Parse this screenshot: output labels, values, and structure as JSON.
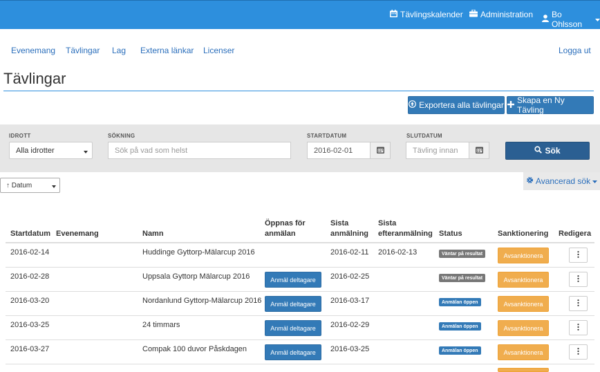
{
  "topbar": {
    "calendar_label": "Tävlingskalender",
    "admin_label": "Administration",
    "user_label": "Bo Ohlsson"
  },
  "subnav": {
    "items": [
      "Evenemang",
      "Tävlingar",
      "Lag",
      "Externa länkar",
      "Licenser"
    ],
    "logout": "Logga ut"
  },
  "page": {
    "title": "Tävlingar",
    "export_label": "Exportera alla tävlingar",
    "create_label": "Skapa en Ny Tävling"
  },
  "filters": {
    "sport_label": "IDROTT",
    "sport_value": "Alla idrotter",
    "search_label": "SÖKNING",
    "search_placeholder": "Sök på vad som helst",
    "start_label": "STARTDATUM",
    "start_value": "2016-02-01",
    "end_label": "SLUTDATUM",
    "end_placeholder": "Tävling innan",
    "search_button": "Sök"
  },
  "sort": {
    "value": "↑ Datum"
  },
  "advanced": {
    "label": "Avancerad sök"
  },
  "table": {
    "headers": {
      "startdatum": "Startdatum",
      "evenemang": "Evenemang",
      "namn": "Namn",
      "oppnas_1": "Öppnas för",
      "oppnas_2": "anmälan",
      "sista_1": "Sista",
      "sista_2": "anmälning",
      "efter_1": "Sista",
      "efter_2": "efteranmälning",
      "status": "Status",
      "sanktionering": "Sanktionering",
      "redigera": "Redigera"
    },
    "register_label": "Anmäl deltagare",
    "sanction_label": "Avsanktionera",
    "rows": [
      {
        "startdatum": "2016-02-14",
        "evenemang": "",
        "namn": "Huddinge Gyttorp-Mälarcup 2016",
        "register": false,
        "sista": "2016-02-11",
        "efter": "2016-02-13",
        "status": "Väntar på resultat",
        "status_color": "#777777"
      },
      {
        "startdatum": "2016-02-28",
        "evenemang": "",
        "namn": "Uppsala Gyttorp Mälarcup 2016",
        "register": true,
        "sista": "2016-02-25",
        "efter": "",
        "status": "Väntar på resultat",
        "status_color": "#777777"
      },
      {
        "startdatum": "2016-03-20",
        "evenemang": "",
        "namn": "Nordanlund Gyttorp-Mälarcup 2016",
        "register": true,
        "sista": "2016-03-17",
        "efter": "",
        "status": "Anmälan öppen",
        "status_color": "#337ab7"
      },
      {
        "startdatum": "2016-03-25",
        "evenemang": "",
        "namn": "24 timmars",
        "register": true,
        "sista": "2016-02-29",
        "efter": "",
        "status": "Anmälan öppen",
        "status_color": "#337ab7"
      },
      {
        "startdatum": "2016-03-27",
        "evenemang": "",
        "namn": "Compak 100 duvor Påskdagen",
        "register": true,
        "sista": "2016-03-25",
        "efter": "",
        "status": "Anmälan öppen",
        "status_color": "#337ab7"
      }
    ]
  },
  "colors": {
    "topbar": "#2d8fdd",
    "primary": "#337ab7",
    "search_button": "#2b5f92",
    "warning": "#f0ad4e"
  }
}
